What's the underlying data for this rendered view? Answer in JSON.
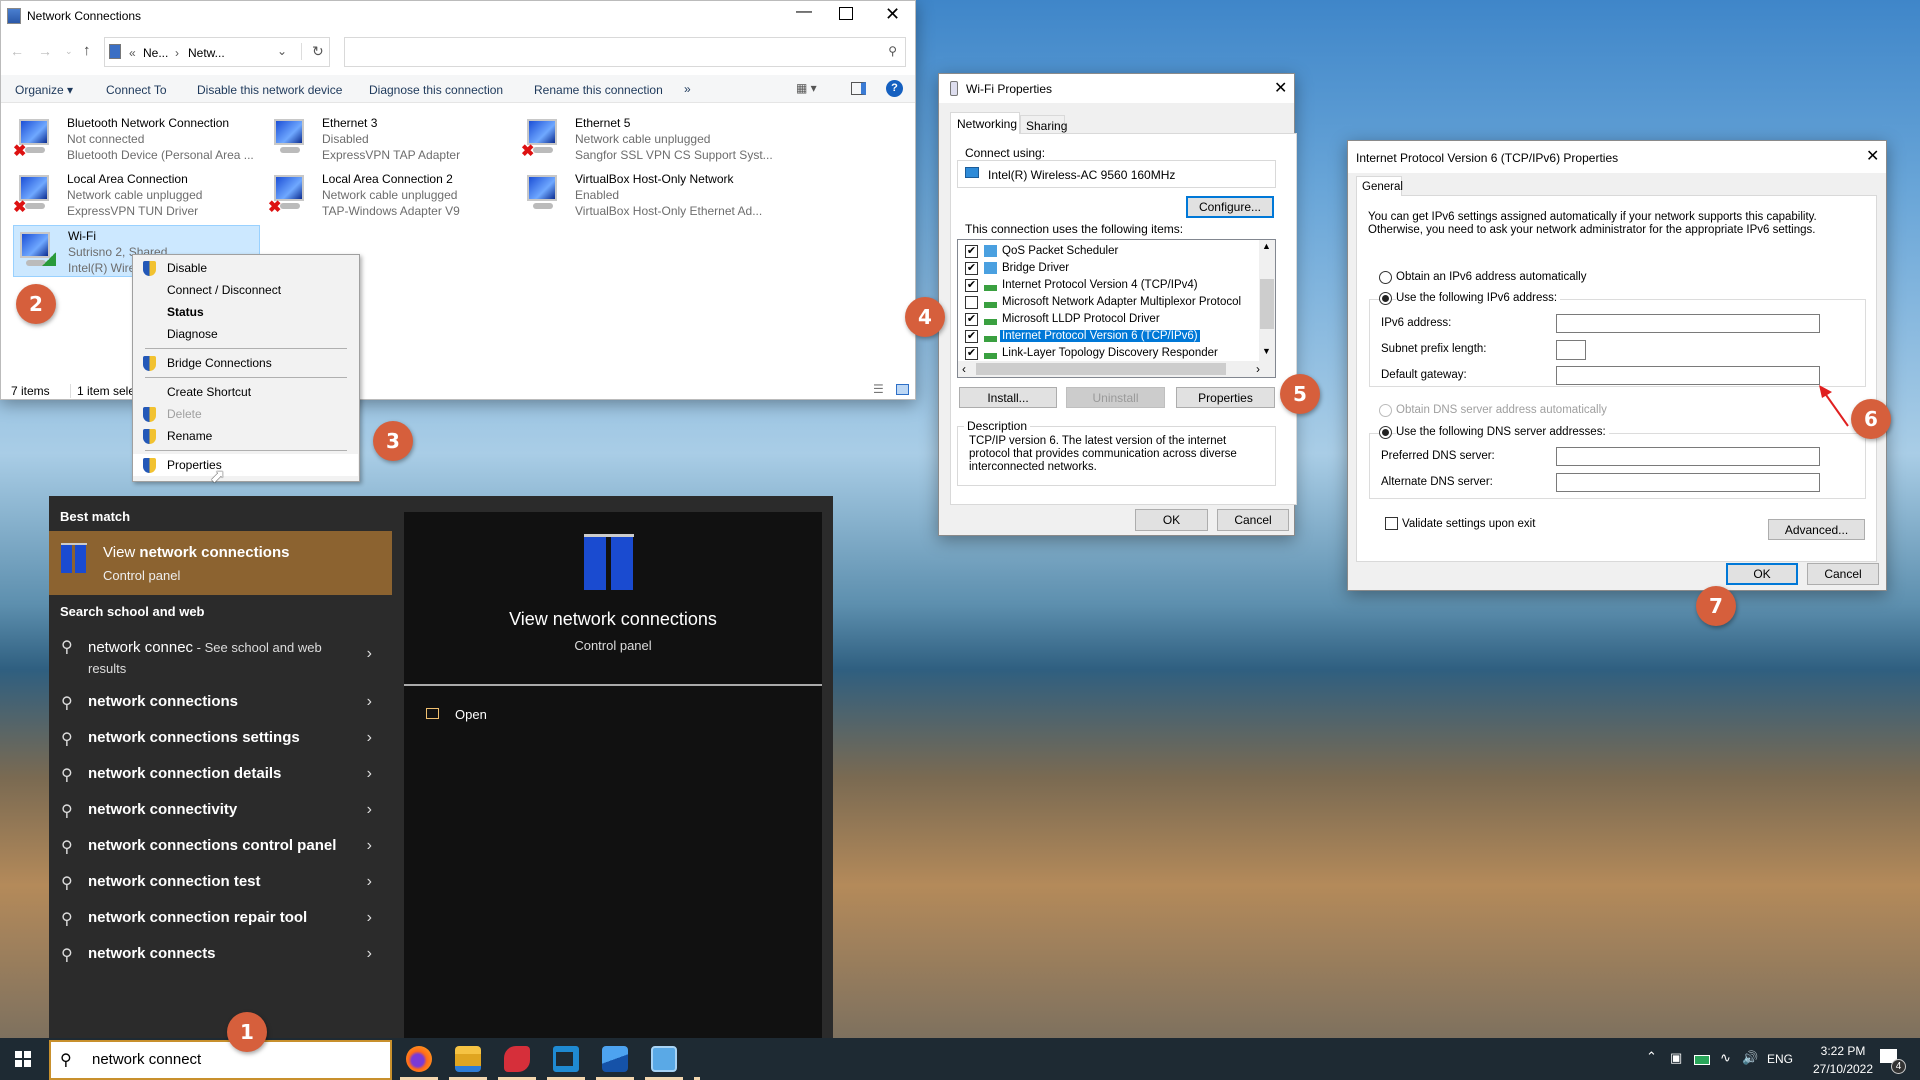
{
  "network_connections": {
    "title": "Network Connections",
    "breadcrumb": [
      "«",
      "Ne...",
      "›",
      "Netw..."
    ],
    "toolbar": [
      "Organize ▾",
      "Connect To",
      "Disable this network device",
      "Diagnose this connection",
      "Rename this connection",
      "»"
    ],
    "items": [
      {
        "name": "Bluetooth Network Connection",
        "status": "Not connected",
        "device": "Bluetooth Device (Personal Area ...",
        "error": true
      },
      {
        "name": "Ethernet 3",
        "status": "Disabled",
        "device": "ExpressVPN TAP Adapter",
        "error": false
      },
      {
        "name": "Ethernet 5",
        "status": "Network cable unplugged",
        "device": "Sangfor SSL VPN CS Support Syst...",
        "error": true
      },
      {
        "name": "Local Area Connection",
        "status": "Network cable unplugged",
        "device": "ExpressVPN TUN Driver",
        "error": true
      },
      {
        "name": "Local Area Connection 2",
        "status": "Network cable unplugged",
        "device": "TAP-Windows Adapter V9",
        "error": true
      },
      {
        "name": "VirtualBox Host-Only Network",
        "status": "Enabled",
        "device": "VirtualBox Host-Only Ethernet Ad...",
        "error": false
      },
      {
        "name": "Wi-Fi",
        "status": "Sutrisno 2, Shared",
        "device": "Intel(R) Wire",
        "error": false,
        "selected": true
      }
    ],
    "status_count": "7 items",
    "status_selected": "1 item selec"
  },
  "context_menu": {
    "items": [
      {
        "label": "Disable",
        "shield": true
      },
      {
        "label": "Connect / Disconnect"
      },
      {
        "label": "Status",
        "bold": true
      },
      {
        "label": "Diagnose",
        "sep_after": true
      },
      {
        "label": "Bridge Connections",
        "shield": true,
        "sep_after": true
      },
      {
        "label": "Create Shortcut"
      },
      {
        "label": "Delete",
        "shield": true,
        "disabled": true
      },
      {
        "label": "Rename",
        "shield": true,
        "sep_after": true
      },
      {
        "label": "Properties",
        "shield": true,
        "hover": true
      }
    ]
  },
  "wifi_props": {
    "title": "Wi-Fi Properties",
    "tabs": [
      "Networking",
      "Sharing"
    ],
    "connect_using_label": "Connect using:",
    "adapter": "Intel(R) Wireless-AC 9560 160MHz",
    "configure": "Configure...",
    "items_label": "This connection uses the following items:",
    "items": [
      {
        "label": "QoS Packet Scheduler",
        "checked": true
      },
      {
        "label": "Bridge Driver",
        "checked": true
      },
      {
        "label": "Internet Protocol Version 4 (TCP/IPv4)",
        "checked": true
      },
      {
        "label": "Microsoft Network Adapter Multiplexor Protocol",
        "checked": false
      },
      {
        "label": "Microsoft LLDP Protocol Driver",
        "checked": true
      },
      {
        "label": "Internet Protocol Version 6 (TCP/IPv6)",
        "checked": true,
        "selected": true
      },
      {
        "label": "Link-Layer Topology Discovery Responder",
        "checked": true
      }
    ],
    "install": "Install...",
    "uninstall": "Uninstall",
    "properties": "Properties",
    "description_label": "Description",
    "description": "TCP/IP version 6. The latest version of the internet protocol that provides communication across diverse interconnected networks.",
    "ok": "OK",
    "cancel": "Cancel"
  },
  "ipv6": {
    "title": "Internet Protocol Version 6 (TCP/IPv6) Properties",
    "tab": "General",
    "intro1": "You can get IPv6 settings assigned automatically if your network supports this capability.",
    "intro2": "Otherwise, you need to ask your network administrator for the appropriate IPv6 settings.",
    "auto_ip": "Obtain an IPv6 address automatically",
    "manual_ip": "Use the following IPv6 address:",
    "ipv6_address": "IPv6 address:",
    "subnet": "Subnet prefix length:",
    "gateway": "Default gateway:",
    "auto_dns": "Obtain DNS server address automatically",
    "manual_dns": "Use the following DNS server addresses:",
    "preferred_dns": "Preferred DNS server:",
    "alternate_dns": "Alternate DNS server:",
    "validate": "Validate settings upon exit",
    "advanced": "Advanced...",
    "ok": "OK",
    "cancel": "Cancel"
  },
  "start_menu": {
    "best_match_heading": "Best match",
    "best_match_title_pre": "View ",
    "best_match_title_bold": "network connections",
    "best_match_sub": "Control panel",
    "web_heading": "Search school and web",
    "web_first": "network connec",
    "web_first_suffix": " - See school and web",
    "web_first_suffix2": "results",
    "suggestions": [
      "network connections",
      "network connections settings",
      "network connection details",
      "network connectivity",
      "network connections control panel",
      "network connection test",
      "network connection repair tool",
      "network connects"
    ],
    "preview_title": "View network connections",
    "preview_sub": "Control panel",
    "open": "Open",
    "accent": "#8c6330"
  },
  "taskbar": {
    "search_value": "network connect",
    "lang": "ENG",
    "time": "3:22 PM",
    "date": "27/10/2022",
    "notifications": "4",
    "apps": [
      "firefox-icon",
      "file-explorer-icon",
      "expressvpn-icon",
      "vscode-icon",
      "photos-icon",
      "control-panel-icon"
    ]
  },
  "badges": [
    "1",
    "2",
    "3",
    "4",
    "5",
    "6",
    "7"
  ],
  "colors": {
    "badge": "#d65f3c",
    "selection": "#cce8ff",
    "accent": "#0078d7"
  }
}
